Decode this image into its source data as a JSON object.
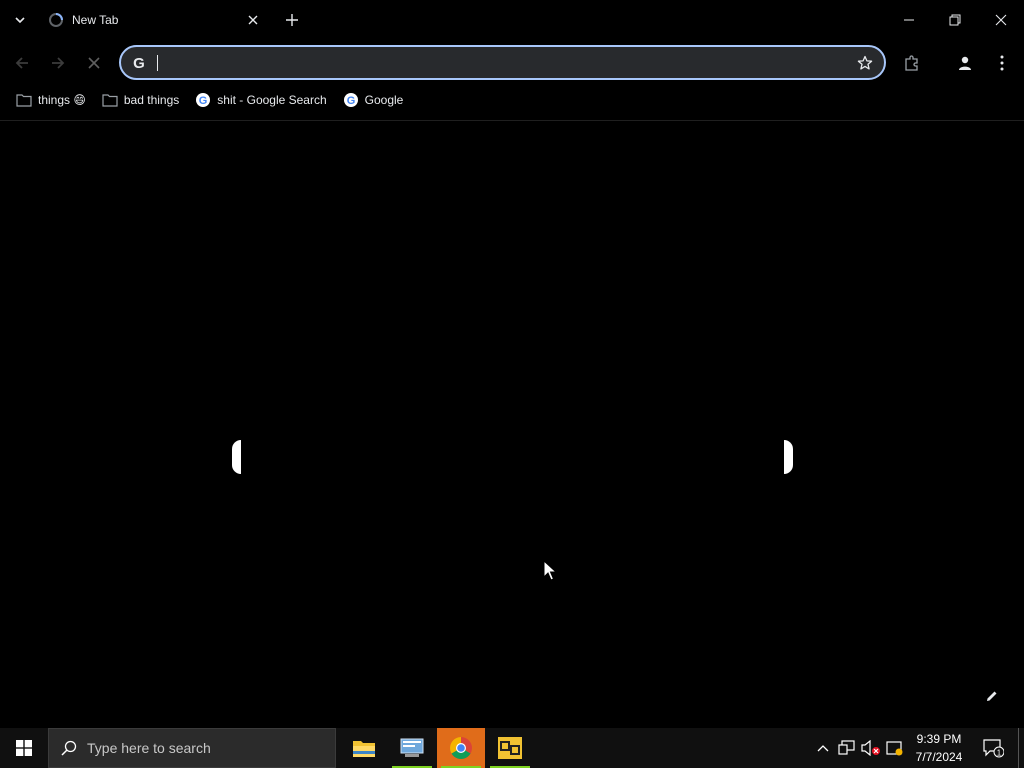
{
  "browser": {
    "tab": {
      "title": "New Tab",
      "favicon": "loading-spinner-icon"
    },
    "window_controls": [
      "minimize-icon",
      "restore-icon",
      "close-icon"
    ],
    "omnibox": {
      "value": "",
      "placeholder": ""
    },
    "bookmarks": [
      {
        "label": "things 😄",
        "icon": "folder-icon"
      },
      {
        "label": "bad things",
        "icon": "folder-icon"
      },
      {
        "label": "shit - Google Search",
        "icon": "google-icon"
      },
      {
        "label": "Google",
        "icon": "google-icon"
      }
    ]
  },
  "taskbar": {
    "search_placeholder": "Type here to search",
    "apps": [
      "file-explorer-icon",
      "control-panel-icon",
      "chrome-icon",
      "vmware-icon"
    ],
    "clock": {
      "time": "9:39 PM",
      "date": "7/7/2024"
    },
    "notification_count": "1"
  },
  "colors": {
    "accent_focus": "#a8c7fa",
    "active_app_bg": "#e06c1a",
    "page_bg": "#000000"
  }
}
